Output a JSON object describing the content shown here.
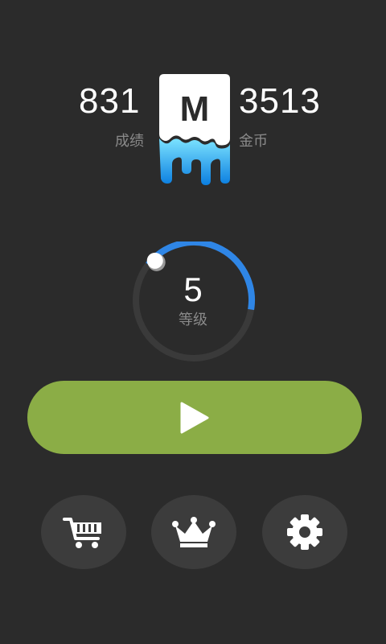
{
  "score": {
    "value": "831",
    "label": "成绩"
  },
  "coins": {
    "value": "3513",
    "label": "金币"
  },
  "logo": {
    "letter": "M"
  },
  "level": {
    "value": "5",
    "label": "等级",
    "progress": 0.42
  },
  "actions": {
    "play": {
      "icon": "play-icon"
    },
    "shop": {
      "icon": "cart-icon"
    },
    "leaderboard": {
      "icon": "crown-icon"
    },
    "settings": {
      "icon": "gear-icon"
    }
  },
  "colors": {
    "background": "#2b2b2b",
    "play_button": "#8bad46",
    "level_ring": "#2f86e6",
    "ring_track": "#3a3a3a",
    "round_button": "#3c3c3c",
    "logo_drip": "#19a0f0"
  }
}
